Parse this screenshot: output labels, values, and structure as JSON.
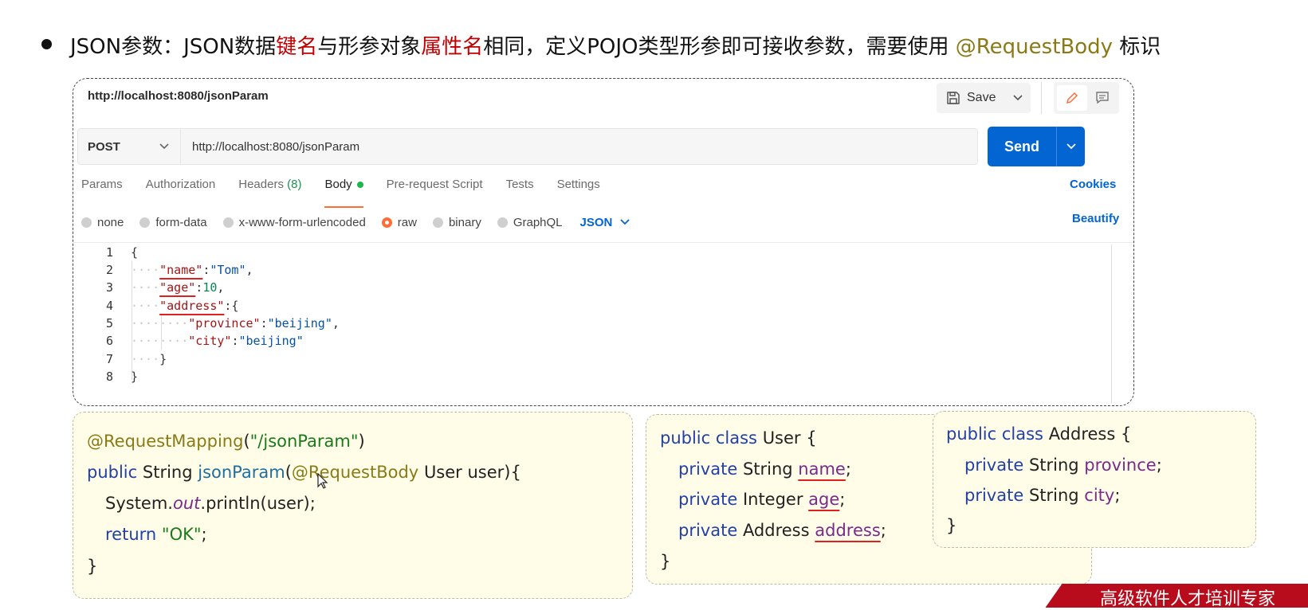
{
  "slide": {
    "title_prefix": "JSON参数：JSON数据",
    "title_key": "键名",
    "title_mid": "与形参对象",
    "title_attr": "属性名",
    "title_rest": "相同，定义POJO类型形参即可接收参数，需要使用 ",
    "title_annotation": "@RequestBody",
    "title_suffix": " 标识"
  },
  "postman": {
    "request_name": "http://localhost:8080/jsonParam",
    "save_label": "Save",
    "method": "POST",
    "url": "http://localhost:8080/jsonParam",
    "send_label": "Send",
    "tabs": {
      "params": "Params",
      "authorization": "Authorization",
      "headers": "Headers",
      "headers_count": "(8)",
      "body": "Body",
      "pre_request": "Pre-request Script",
      "tests": "Tests",
      "settings": "Settings"
    },
    "cookies_label": "Cookies",
    "body_types": {
      "none": "none",
      "form_data": "form-data",
      "urlencoded": "x-www-form-urlencoded",
      "raw": "raw",
      "binary": "binary",
      "graphql": "GraphQL"
    },
    "selected_body_type": "raw",
    "format": "JSON",
    "beautify_label": "Beautify",
    "line_numbers": [
      "1",
      "2",
      "3",
      "4",
      "5",
      "6",
      "7",
      "8"
    ],
    "json": {
      "open": "{",
      "key_name": "\"name\"",
      "val_name": "\"Tom\"",
      "key_age": "\"age\"",
      "val_age": "10",
      "key_address": "\"address\"",
      "key_province": "\"province\"",
      "val_province": "\"beijing\"",
      "key_city": "\"city\"",
      "val_city": "\"beijing\"",
      "close_inner": "}",
      "close": "}"
    }
  },
  "controller_code": {
    "annotation": "@RequestMapping",
    "mapping_path": "\"/jsonParam\"",
    "kw_public": "public",
    "type_string": "String",
    "method_name": "jsonParam",
    "param_annotation": "@RequestBody",
    "param": "User user){",
    "print_prefix": "System.",
    "print_out": "out",
    "print_suffix": ".println(user);",
    "kw_return": "return",
    "return_value": "\"OK\"",
    "close": "}"
  },
  "user_class": {
    "decl_kw": "public class",
    "decl_name": "User {",
    "kw_private": "private",
    "f1_type": "String",
    "f1_name": "name",
    "f2_type": "Integer",
    "f2_name": "age",
    "f3_type": "Address",
    "f3_name": "address",
    "close": "}"
  },
  "address_class": {
    "decl_kw": "public class",
    "decl_name": "Address {",
    "kw_private": "private",
    "f1_type": "String",
    "f1_name": "province",
    "f2_type": "String",
    "f2_name": "city",
    "close": "}"
  },
  "banner": {
    "text": "高级软件人才培训专家"
  },
  "colors": {
    "title_red": "#c00000",
    "annotation_olive": "#8a7a16",
    "send_blue": "#0265d2",
    "active_tab_orange": "#ff6c37",
    "box_background": "#fffde8",
    "banner_red": "#b80c1c"
  }
}
